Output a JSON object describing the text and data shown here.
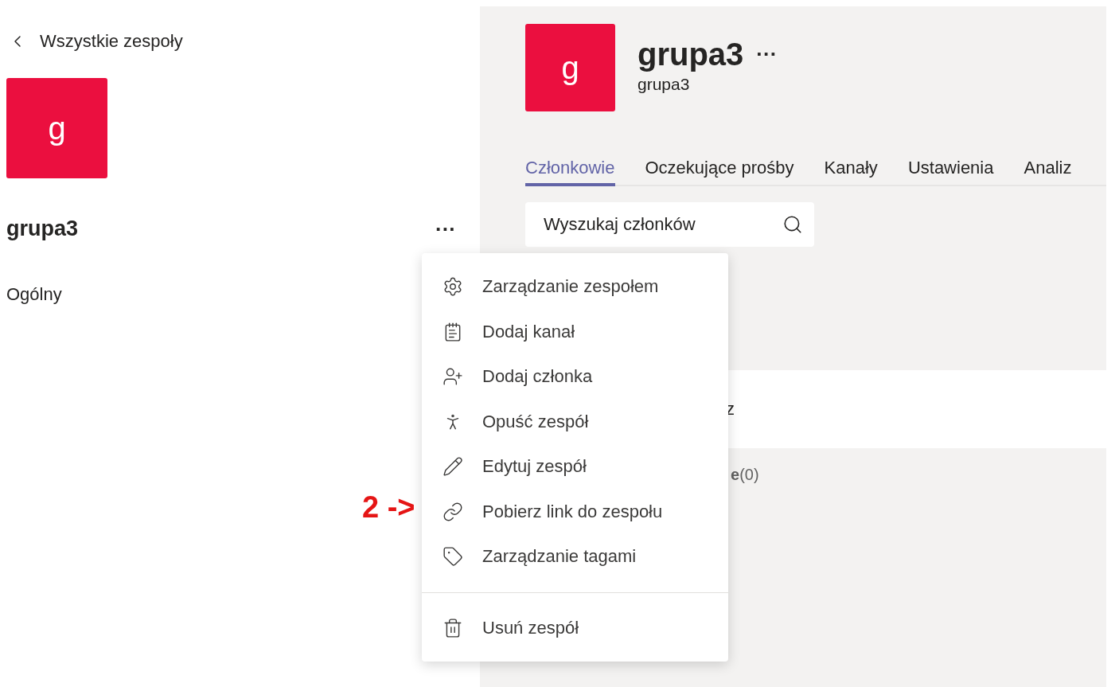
{
  "sidebar": {
    "back_link": "Wszystkie zespoły",
    "team_avatar": "g",
    "team_name": "grupa3",
    "more": "···",
    "channels": [
      "Ogólny"
    ]
  },
  "team": {
    "avatar": "g",
    "title": "grupa3",
    "more": "···",
    "subtitle": "grupa3"
  },
  "tabs": [
    {
      "label": "Członkowie",
      "selected": true
    },
    {
      "label": "Oczekujące prośby",
      "selected": false
    },
    {
      "label": "Kanały",
      "selected": false
    },
    {
      "label": "Ustawienia",
      "selected": false
    },
    {
      "label": "Analiz",
      "selected": false
    }
  ],
  "search": {
    "placeholder": "Wyszukaj członków"
  },
  "band_text": "z",
  "section_text": "**e**(0)",
  "menu": {
    "sections": [
      {
        "items": [
          "Zarządzanie zespołem",
          "Dodaj kanał",
          "Dodaj członka",
          "Opuść zespół",
          "Edytuj zespół",
          "Pobierz link do zespołu",
          "Zarządzanie tagami"
        ]
      },
      {
        "items": [
          "Usuń zespół"
        ]
      }
    ]
  },
  "annotation": "2 ->"
}
